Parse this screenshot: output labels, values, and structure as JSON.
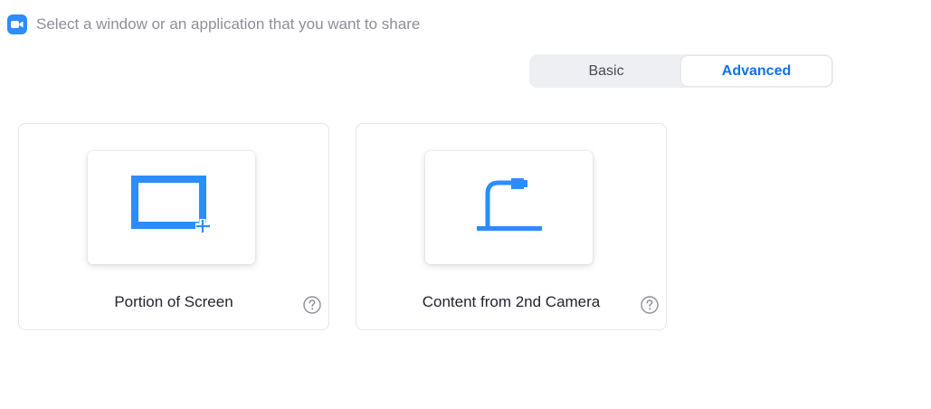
{
  "header": {
    "app_icon": "video-camera-icon",
    "prompt": "Select a window or an application that you want to share"
  },
  "tabs": [
    {
      "label": "Basic",
      "active": false
    },
    {
      "label": "Advanced",
      "active": true
    }
  ],
  "options": [
    {
      "label": "Portion of Screen",
      "icon": "screen-portion-icon",
      "help_icon": "help-icon"
    },
    {
      "label": "Content from 2nd Camera",
      "icon": "document-camera-icon",
      "help_icon": "help-icon"
    }
  ],
  "colors": {
    "accent": "#2d8cff",
    "active_tab_text": "#0e72ed",
    "header_text": "#8e8e99",
    "label_text": "#232333"
  }
}
